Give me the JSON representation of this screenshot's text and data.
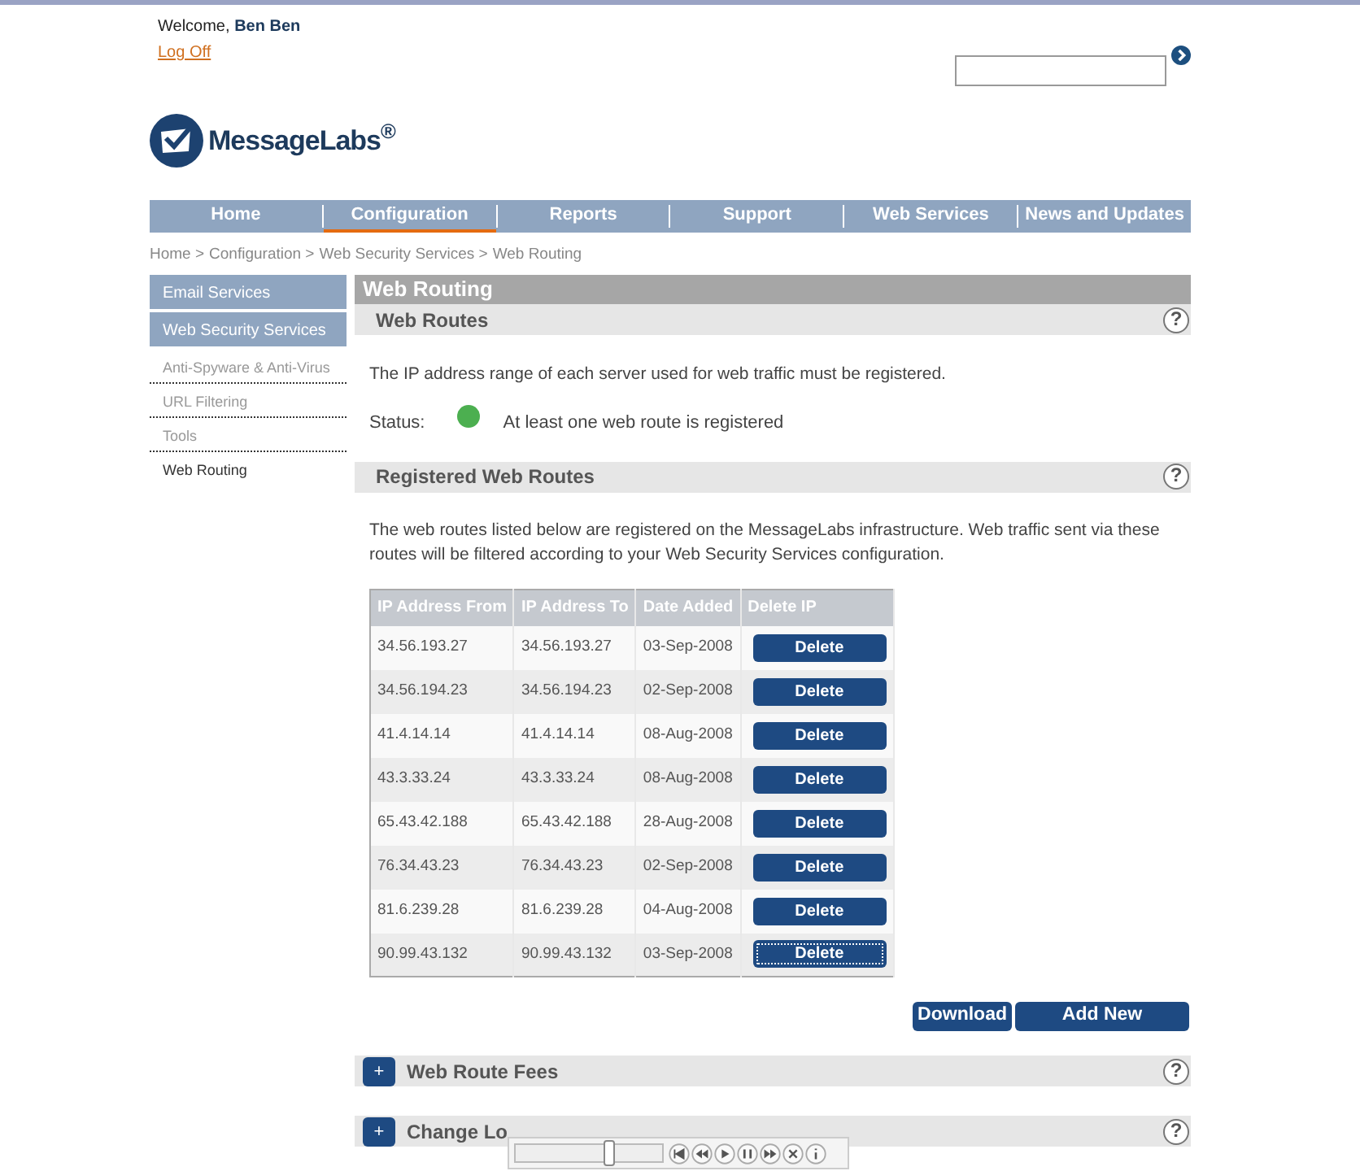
{
  "header": {
    "welcome": "Welcome,",
    "user": "Ben Ben",
    "logoff": "Log Off"
  },
  "logo": {
    "text": "MessageLabs$^{®}$"
  },
  "nav": [
    {
      "label": "Home",
      "selected": false
    },
    {
      "label": "Configuration",
      "selected": true
    },
    {
      "label": "Reports",
      "selected": false
    },
    {
      "label": "Support",
      "selected": false
    },
    {
      "label": "Web Services",
      "selected": false
    },
    {
      "label": "News and Updates",
      "selected": false
    }
  ],
  "breadcrumb": {
    "links": [
      "Home >",
      "Configuration >",
      "Web Security Services >"
    ],
    "current": "Web Routing"
  },
  "sidebar": [
    {
      "kind": "main",
      "label": "Email Services",
      "selected": false
    },
    {
      "kind": "main",
      "label": "Web Security Services",
      "selected": false
    },
    {
      "kind": "sub",
      "label": "Anti-Spyware & Anti-Virus",
      "selected": false
    },
    {
      "kind": "sub",
      "label": "URL Filtering",
      "selected": false
    },
    {
      "kind": "sub",
      "label": "Tools",
      "selected": false
    },
    {
      "kind": "sub",
      "label": "Web Routing",
      "selected": true
    }
  ],
  "page_title": "Web Routing",
  "web_routes": {
    "title": "Web Routes",
    "help": "?",
    "text": "The IP address range of each server used for web traffic must be registered.",
    "status_label": "Status:",
    "status_ok": true,
    "status_text": "At least one web route is registered"
  },
  "registered": {
    "title": "Registered Web Routes",
    "help": "?",
    "text": "The web routes listed below are registered on the MessageLabs infrastructure. Web traffic sent via these routes will be filtered according to your Web Security Services configuration.",
    "columns": [
      "IP Address From",
      "IP Address To",
      "Date Added",
      "Delete IP"
    ],
    "rows": [
      {
        "from": "34.56.193.27",
        "to": "34.56.193.27",
        "date": "03-Sep-2008",
        "button": "Delete",
        "focused": false
      },
      {
        "from": "34.56.194.23",
        "to": "34.56.194.23",
        "date": "02-Sep-2008",
        "button": "Delete",
        "focused": false
      },
      {
        "from": "41.4.14.14",
        "to": "41.4.14.14",
        "date": "08-Aug-2008",
        "button": "Delete",
        "focused": false
      },
      {
        "from": "43.3.33.24",
        "to": "43.3.33.24",
        "date": "08-Aug-2008",
        "button": "Delete",
        "focused": false
      },
      {
        "from": "65.43.42.188",
        "to": "65.43.42.188",
        "date": "28-Aug-2008",
        "button": "Delete",
        "focused": false
      },
      {
        "from": "76.34.43.23",
        "to": "76.34.43.23",
        "date": "02-Sep-2008",
        "button": "Delete",
        "focused": false
      },
      {
        "from": "81.6.239.28",
        "to": "81.6.239.28",
        "date": "04-Aug-2008",
        "button": "Delete",
        "focused": false
      },
      {
        "from": "90.99.43.132",
        "to": "90.99.43.132",
        "date": "03-Sep-2008",
        "button": "Delete",
        "focused": true
      }
    ],
    "buttons": [
      "Download",
      "Add New"
    ]
  },
  "collapsed_sections": [
    {
      "expand": "+",
      "title": "Web Route Fees",
      "help": "?"
    },
    {
      "expand": "+",
      "title": "Change Lo",
      "help": "?"
    }
  ],
  "player": {
    "level": 0.63
  }
}
